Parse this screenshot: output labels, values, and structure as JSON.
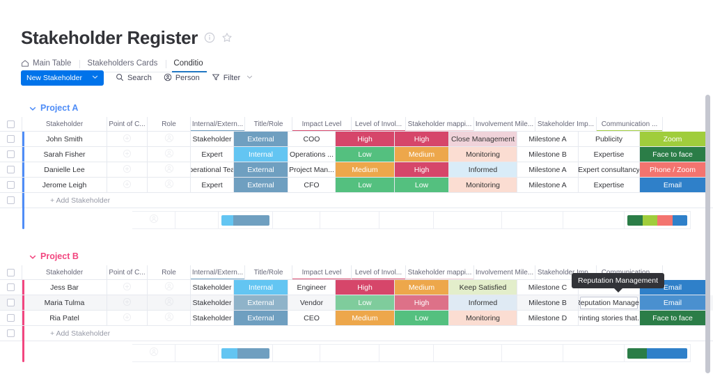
{
  "header": {
    "title": "Stakeholder Register",
    "info_icon": "info-circle-icon",
    "star_icon": "star-icon",
    "tabs": [
      {
        "label": "Main Table",
        "icon": "home-icon",
        "active": false
      },
      {
        "label": "Stakeholders Cards",
        "icon": "",
        "active": false
      },
      {
        "label": "Conditio",
        "icon": "",
        "active": true
      }
    ]
  },
  "toolbar": {
    "new_button": "New Stakeholder",
    "new_button_caret": "chevron-down-icon",
    "search": "Search",
    "person": "Person",
    "filter": "Filter",
    "filter_caret": "chevron-down-icon",
    "accent": "#0073ea"
  },
  "columns": [
    {
      "key": "stakeholder",
      "label": "Stakeholder"
    },
    {
      "key": "poc",
      "label": "Point of C..."
    },
    {
      "key": "role",
      "label": "Role"
    },
    {
      "key": "intext",
      "label": "Internal/Extern...",
      "underline": "#6f9fc0"
    },
    {
      "key": "titlerole",
      "label": "Title/Role"
    },
    {
      "key": "impact",
      "label": "Impact Level",
      "underline": "#d6466a"
    },
    {
      "key": "involve",
      "label": "Level of Invol...",
      "underline": "#d6466a"
    },
    {
      "key": "mapping",
      "label": "Stakeholder mappi...",
      "underline": "#f2cdd4"
    },
    {
      "key": "milestone",
      "label": "Involvement Mile..."
    },
    {
      "key": "importance",
      "label": "Stakeholder Imp..."
    },
    {
      "key": "comm",
      "label": "Communication ...",
      "underline": "#a0cd3c"
    }
  ],
  "groups": [
    {
      "name": "Project A",
      "color": "#4f8df7",
      "collapse_icon": "chevron-down-icon",
      "add_label": "+ Add Stakeholder",
      "rows": [
        {
          "stakeholder": "John Smith",
          "role": "Stakeholder",
          "intext": {
            "text": "External",
            "bg": "#6f9fc0"
          },
          "titlerole": "COO",
          "impact": {
            "text": "High",
            "bg": "#d6466a"
          },
          "involve": {
            "text": "High",
            "bg": "#d6466a"
          },
          "mapping": {
            "text": "Close Management",
            "bg": "#f0d3da"
          },
          "milestone": "Milestone A",
          "importance": "Publicity",
          "comm": {
            "text": "Zoom",
            "bg": "#a0cd3c"
          }
        },
        {
          "stakeholder": "Sarah Fisher",
          "role": "Expert",
          "intext": {
            "text": "Internal",
            "bg": "#63c5f2"
          },
          "titlerole": "Operations ...",
          "impact": {
            "text": "Low",
            "bg": "#54c07f"
          },
          "involve": {
            "text": "Medium",
            "bg": "#eda74b"
          },
          "mapping": {
            "text": "Monitoring",
            "bg": "#fbddd2"
          },
          "milestone": "Milestone B",
          "importance": "Expertise",
          "comm": {
            "text": "Face to face",
            "bg": "#2b7d47"
          }
        },
        {
          "stakeholder": "Danielle Lee",
          "role": "Operational Tea...",
          "intext": {
            "text": "External",
            "bg": "#6f9fc0"
          },
          "titlerole": "Project Man...",
          "impact": {
            "text": "Medium",
            "bg": "#eda74b"
          },
          "involve": {
            "text": "High",
            "bg": "#d6466a"
          },
          "mapping": {
            "text": "Informed",
            "bg": "#d9ecf8"
          },
          "milestone": "Milestone A",
          "importance": "Expert consultancy",
          "comm": {
            "text": "Phone / Zoom",
            "bg": "#f3746f"
          }
        },
        {
          "stakeholder": "Jerome Leigh",
          "role": "Expert",
          "intext": {
            "text": "External",
            "bg": "#6f9fc0"
          },
          "titlerole": "CFO",
          "impact": {
            "text": "Low",
            "bg": "#54c07f"
          },
          "involve": {
            "text": "Low",
            "bg": "#54c07f"
          },
          "mapping": {
            "text": "Monitoring",
            "bg": "#fbddd2"
          },
          "milestone": "Milestone A",
          "importance": "Expertise",
          "comm": {
            "text": "Email",
            "bg": "#2f80c9"
          }
        }
      ],
      "summary": {
        "intext_bar": [
          {
            "color": "#63c5f2",
            "pct": 25
          },
          {
            "color": "#6f9fc0",
            "pct": 75
          }
        ],
        "comm_bar": [
          {
            "color": "#2b7d47",
            "pct": 25
          },
          {
            "color": "#a0cd3c",
            "pct": 25
          },
          {
            "color": "#f3746f",
            "pct": 25
          },
          {
            "color": "#2f80c9",
            "pct": 25
          }
        ]
      }
    },
    {
      "name": "Project B",
      "color": "#f2467f",
      "collapse_icon": "chevron-down-icon",
      "add_label": "+ Add Stakeholder",
      "rows": [
        {
          "stakeholder": "Jess Bar",
          "role": "Stakeholder",
          "intext": {
            "text": "Internal",
            "bg": "#63c5f2"
          },
          "titlerole": "Engineer",
          "impact": {
            "text": "High",
            "bg": "#d6466a"
          },
          "involve": {
            "text": "Medium",
            "bg": "#eda74b"
          },
          "mapping": {
            "text": "Keep Satisfied",
            "bg": "#e3eecb"
          },
          "milestone": "Milestone C",
          "importance": "",
          "comm": {
            "text": "Email",
            "bg": "#2f80c9"
          }
        },
        {
          "stakeholder": "Maria Tulma",
          "role": "Stakeholder",
          "hovered": true,
          "intext": {
            "text": "External",
            "bg": "#8fb3c9"
          },
          "titlerole": "Vendor",
          "impact": {
            "text": "Low",
            "bg": "#7fcc9c"
          },
          "involve": {
            "text": "High",
            "bg": "#dd7188"
          },
          "mapping": {
            "text": "Informed",
            "bg": "#dfeaf4"
          },
          "milestone": "Milestone B",
          "importance": "Reputation Manage",
          "comm": {
            "text": "Email",
            "bg": "#4a90cf"
          }
        },
        {
          "stakeholder": "Ria Patel",
          "role": "Stakeholder",
          "intext": {
            "text": "External",
            "bg": "#6f9fc0"
          },
          "titlerole": "CEO",
          "impact": {
            "text": "Medium",
            "bg": "#eda74b"
          },
          "involve": {
            "text": "Low",
            "bg": "#54c07f"
          },
          "mapping": {
            "text": "Monitoring",
            "bg": "#fbddd2"
          },
          "milestone": "Milestone D",
          "importance": "Printing stories that...",
          "comm": {
            "text": "Face to face",
            "bg": "#2b7d47"
          }
        }
      ],
      "summary": {
        "intext_bar": [
          {
            "color": "#63c5f2",
            "pct": 33
          },
          {
            "color": "#6f9fc0",
            "pct": 67
          }
        ],
        "comm_bar": [
          {
            "color": "#2b7d47",
            "pct": 33
          },
          {
            "color": "#2f80c9",
            "pct": 67
          }
        ]
      }
    }
  ],
  "tooltip": {
    "text": "Reputation Management"
  }
}
